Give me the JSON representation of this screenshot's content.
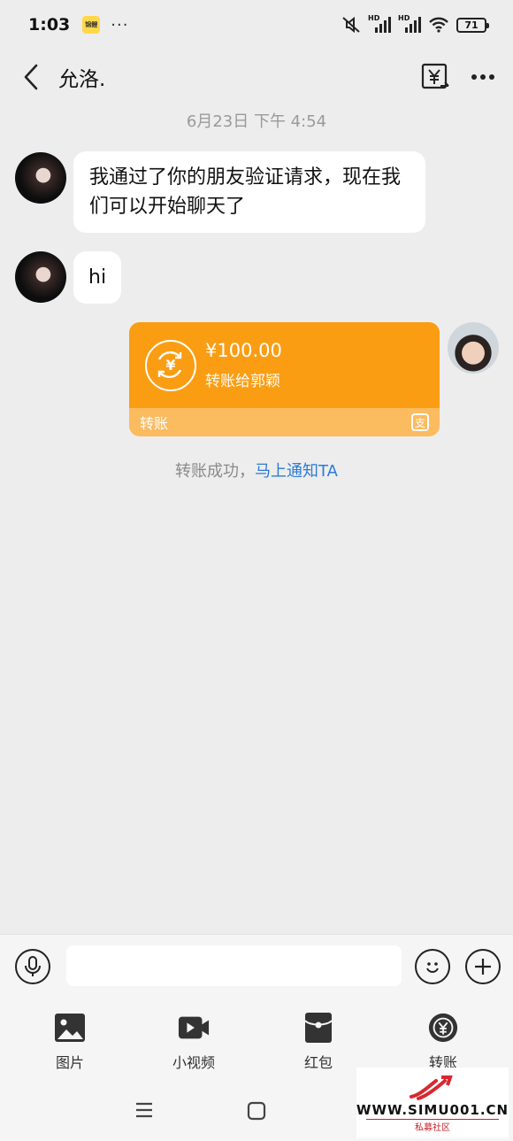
{
  "status_bar": {
    "time": "1:03",
    "app_icon_text": "锦鲤",
    "more": "···",
    "network_1": "HD",
    "network_2": "HD",
    "battery": "71"
  },
  "header": {
    "title": "允洛."
  },
  "chat": {
    "timestamp": "6月23日 下午 4:54",
    "messages": [
      {
        "text": "我通过了你的朋友验证请求，现在我们可以开始聊天了"
      },
      {
        "text": "hi"
      }
    ],
    "transfer": {
      "amount": "¥100.00",
      "description": "转账给郭颖",
      "label": "转账",
      "icon_char": "¥",
      "provider_badge": "支"
    },
    "system_message": "转账成功，",
    "system_link": "马上通知TA"
  },
  "input": {
    "value": "",
    "placeholder": ""
  },
  "tools": [
    {
      "label": "图片",
      "icon": "image-icon"
    },
    {
      "label": "小视频",
      "icon": "video-icon"
    },
    {
      "label": "红包",
      "icon": "red-packet-icon"
    },
    {
      "label": "转账",
      "icon": "transfer-icon"
    }
  ],
  "watermark": {
    "text": "WWW.SIMU001.CN",
    "sub": "私募社区"
  },
  "colors": {
    "transfer_orange": "#fa9d13",
    "transfer_light": "#fbbb5f",
    "link_blue": "#2d7bd8",
    "background": "#ededed"
  }
}
